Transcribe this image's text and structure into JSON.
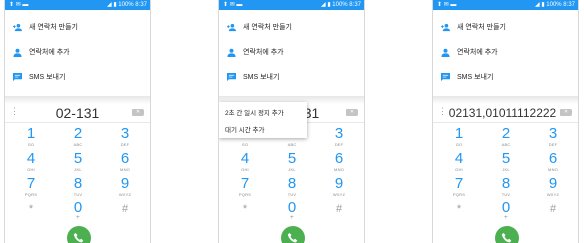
{
  "status_bar": {
    "left_icons": "⬆ ✉ ▬",
    "right": "◢ ▮ 100% 8:37"
  },
  "menu": {
    "new_contact": "새 연락처 만들기",
    "add_to_contact": "연락처에 추가",
    "send_sms": "SMS 보내기"
  },
  "screens": [
    {
      "number": "02-131"
    },
    {
      "number": "31"
    },
    {
      "number": "02131,01011112222"
    }
  ],
  "popup": {
    "pause": "2초 간 일시 정지 추가",
    "wait": "대기 시간 추가"
  },
  "keypad": [
    {
      "digit": "1",
      "letters": "GO"
    },
    {
      "digit": "2",
      "letters": "ABC"
    },
    {
      "digit": "3",
      "letters": "DEF"
    },
    {
      "digit": "4",
      "letters": "GHI"
    },
    {
      "digit": "5",
      "letters": "JKL"
    },
    {
      "digit": "6",
      "letters": "MNO"
    },
    {
      "digit": "7",
      "letters": "PQRS"
    },
    {
      "digit": "8",
      "letters": "TUV"
    },
    {
      "digit": "9",
      "letters": "WXYZ"
    },
    {
      "digit": "*",
      "letters": ""
    },
    {
      "digit": "0",
      "letters": "+"
    },
    {
      "digit": "#",
      "letters": ""
    }
  ],
  "colors": {
    "accent": "#2196f3",
    "call": "#4caf50"
  },
  "icons": [
    "add-contact-icon",
    "person-icon",
    "message-icon",
    "backspace-icon",
    "phone-icon",
    "overflow-icon"
  ]
}
